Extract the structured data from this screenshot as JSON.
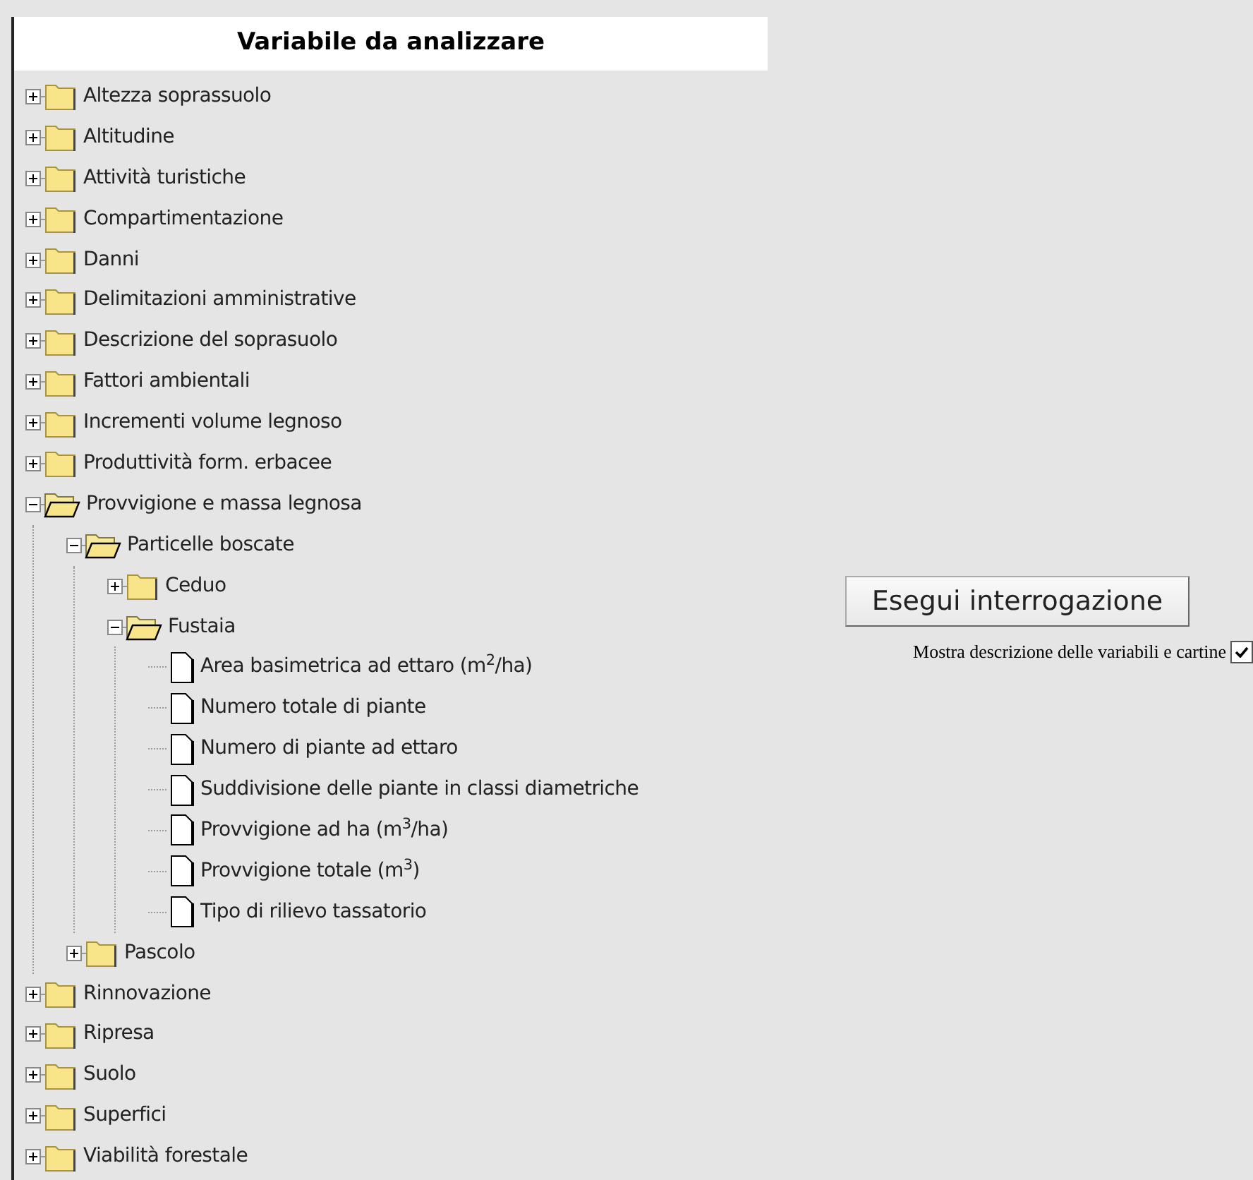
{
  "panel": {
    "title": "Variabile da analizzare"
  },
  "tree": [
    {
      "label": "Altezza soprassuolo",
      "kind": "folder",
      "expanded": false
    },
    {
      "label": "Altitudine",
      "kind": "folder",
      "expanded": false
    },
    {
      "label": "Attività turistiche",
      "kind": "folder",
      "expanded": false
    },
    {
      "label": "Compartimentazione",
      "kind": "folder",
      "expanded": false
    },
    {
      "label": "Danni",
      "kind": "folder",
      "expanded": false
    },
    {
      "label": "Delimitazioni amministrative",
      "kind": "folder",
      "expanded": false
    },
    {
      "label": "Descrizione del soprasuolo",
      "kind": "folder",
      "expanded": false
    },
    {
      "label": "Fattori ambientali",
      "kind": "folder",
      "expanded": false
    },
    {
      "label": "Incrementi volume legnoso",
      "kind": "folder",
      "expanded": false
    },
    {
      "label": "Produttività form. erbacee",
      "kind": "folder",
      "expanded": false
    },
    {
      "label": "Provvigione e massa legnosa",
      "kind": "folder",
      "expanded": true,
      "children": [
        {
          "label": "Particelle boscate",
          "kind": "folder",
          "expanded": true,
          "children": [
            {
              "label": "Ceduo",
              "kind": "folder",
              "expanded": false
            },
            {
              "label": "Fustaia",
              "kind": "folder",
              "expanded": true,
              "children": [
                {
                  "label": "Area basimetrica ad ettaro (m$^{2}$/ha)",
                  "kind": "file"
                },
                {
                  "label": "Numero totale di piante",
                  "kind": "file"
                },
                {
                  "label": "Numero di piante ad ettaro",
                  "kind": "file"
                },
                {
                  "label": "Suddivisione delle piante in classi diametriche",
                  "kind": "file"
                },
                {
                  "label": "Provvigione ad ha (m$^{3}$/ha)",
                  "kind": "file"
                },
                {
                  "label": "Provvigione totale (m$^{3}$)",
                  "kind": "file"
                },
                {
                  "label": "Tipo di rilievo tassatorio",
                  "kind": "file"
                }
              ]
            }
          ]
        },
        {
          "label": "Pascolo",
          "kind": "folder",
          "expanded": false
        }
      ]
    },
    {
      "label": "Rinnovazione",
      "kind": "folder",
      "expanded": false
    },
    {
      "label": "Ripresa",
      "kind": "folder",
      "expanded": false
    },
    {
      "label": "Suolo",
      "kind": "folder",
      "expanded": false
    },
    {
      "label": "Superfici",
      "kind": "folder",
      "expanded": false
    },
    {
      "label": "Viabilità forestale",
      "kind": "folder",
      "expanded": false
    }
  ],
  "run_button": "Esegui interrogazione",
  "show_description": {
    "label": "Mostra descrizione delle variabili e cartine",
    "checked": true
  }
}
